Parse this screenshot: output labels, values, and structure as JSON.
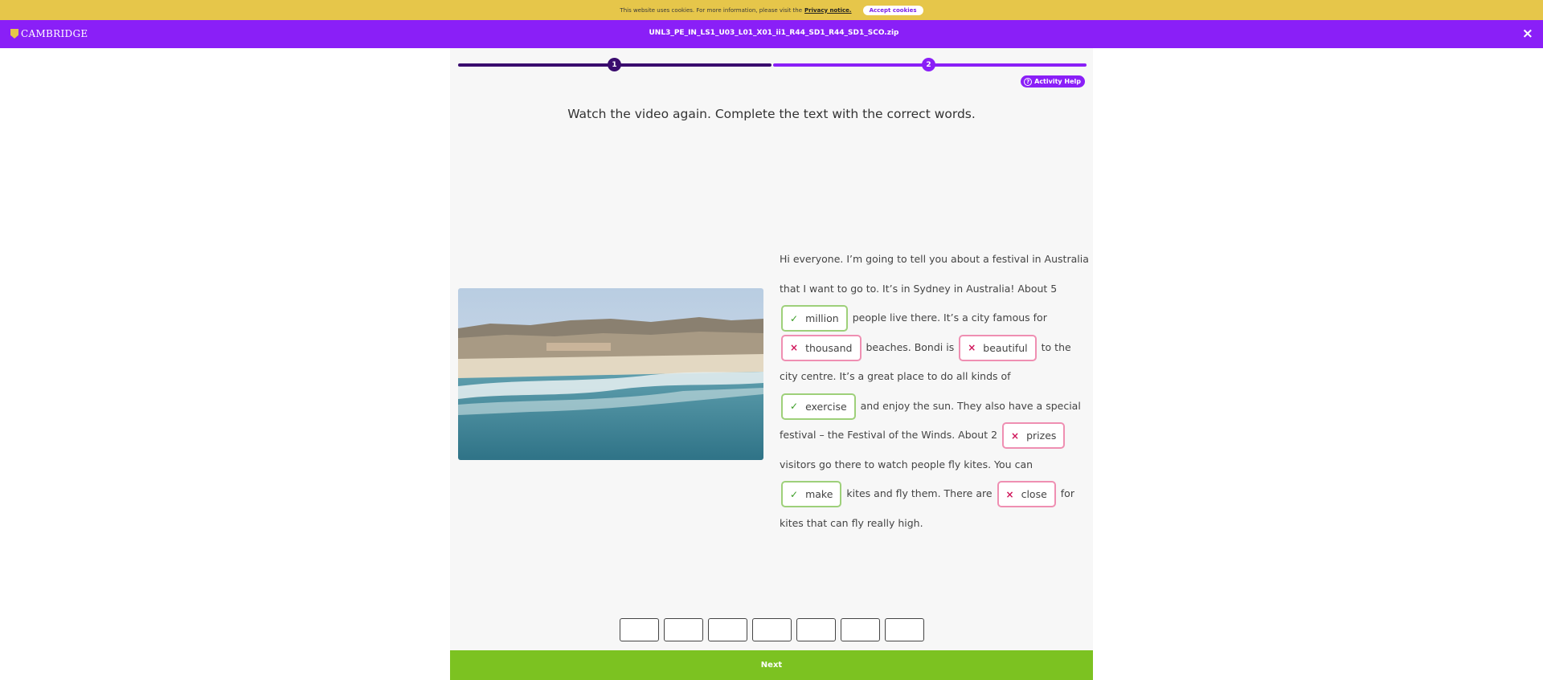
{
  "cookie": {
    "text": "This website uses cookies. For more information, please visit the",
    "privacy_link": "Privacy notice.",
    "accept_label": "Accept cookies"
  },
  "header": {
    "logo_text": "CAMBRIDGE",
    "title": "UNL3_PE_IN_LS1_U03_L01_X01_ii1_R44_SD1_R44_SD1_SCO.zip",
    "close_icon": "×"
  },
  "progress": {
    "steps": [
      "1",
      "2"
    ],
    "current_step": 2
  },
  "activity_help": "Activity Help",
  "instruction": "Watch the video again. Complete the text with the correct words.",
  "passage": {
    "t0": "Hi everyone. I’m going to tell you about a festival in Australia that I want to go to. It’s in Sydney in Australia! About 5",
    "t1": "people live there. It’s a city famous for",
    "t2": "beaches. Bondi is",
    "t3": "to the city centre. It’s a great place to do all kinds of",
    "t4": "and enjoy the sun. They also have a special festival – the Festival of the Winds. About 2",
    "t5": "visitors go there to watch people fly kites. You can",
    "t6": "kites and fly them. There are",
    "t7": "for kites that can fly really high.",
    "gaps": [
      {
        "word": "million",
        "status": "correct"
      },
      {
        "word": "thousand",
        "status": "wrong"
      },
      {
        "word": "beautiful",
        "status": "wrong"
      },
      {
        "word": "exercise",
        "status": "correct"
      },
      {
        "word": "prizes",
        "status": "wrong"
      },
      {
        "word": "make",
        "status": "correct"
      },
      {
        "word": "close",
        "status": "wrong"
      }
    ]
  },
  "marks": {
    "correct": "✓",
    "wrong": "×"
  },
  "colors": {
    "accent": "#8a1ff7",
    "dark_accent": "#3a0c6e",
    "cookie_bar": "#e6c64a",
    "next": "#7cc221",
    "correct": "#9ed07a",
    "wrong": "#ef8fb2"
  },
  "answer_boxes": 7,
  "next_label": "Next"
}
